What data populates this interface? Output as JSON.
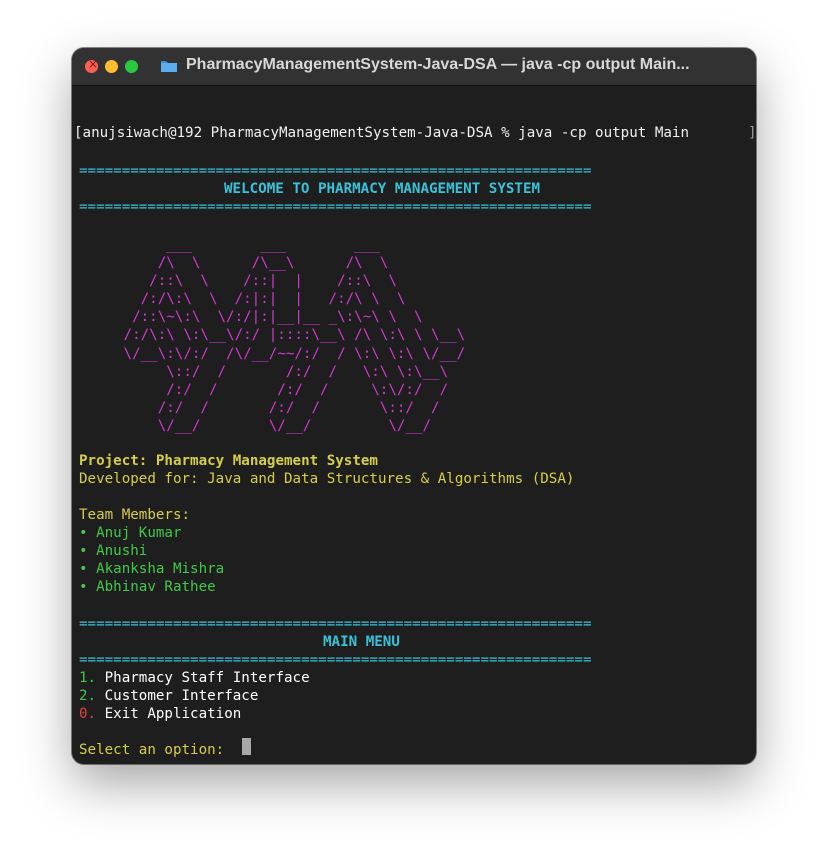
{
  "window": {
    "title": "PharmacyManagementSystem-Java-DSA — java -cp output Main..."
  },
  "terminal": {
    "prompt": "[anujsiwach@192 PharmacyManagementSystem-Java-DSA % java -cp output Main",
    "prompt_end": "]",
    "separator": "============================================================",
    "welcome": "WELCOME TO PHARMACY MANAGEMENT SYSTEM",
    "ascii_art": "      ___        ___        ___\n     /\\  \\      /\\__\\      /\\  \\\n    /::\\  \\    /::|  |    /::\\  \\\n   /:/\\:\\  \\  /:|:|  |   /:/\\ \\  \\\n  /::\\~\\:\\  \\/:/|:|__|__ _\\:\\~\\ \\  \\\n /:/\\:\\ \\:\\__\\/:/ |::::\\__\\ /\\ \\:\\ \\ \\__\\\n \\/__\\:\\/:/  /\\/__/~~/:/  / \\:\\ \\:\\ \\/__/\n      \\::/  /       /:/  /   \\:\\ \\:\\__\\\n      /:/  /       /:/  /     \\:\\/:/  /\n     /:/  /       /:/  /       \\::/  /\n     \\/__/        \\/__/         \\/__/",
    "project_line": "Project: Pharmacy Management System",
    "developed_line": "Developed for: Java and Data Structures & Algorithms (DSA)",
    "team_label": "Team Members:",
    "team_members": [
      "Anuj Kumar",
      "Anushi",
      "Akanksha Mishra",
      "Abhinav Rathee"
    ],
    "bullet": "•",
    "menu_title": "MAIN MENU",
    "menu_items": [
      {
        "number": "1.",
        "label": "Pharmacy Staff Interface"
      },
      {
        "number": "2.",
        "label": "Customer Interface"
      },
      {
        "number": "0.",
        "label": "Exit Application"
      }
    ],
    "select_prompt": "Select an option: "
  },
  "colors": {
    "separator": "#39c2d9",
    "ascii": "#d338d2",
    "project": "#d6cf45",
    "team": "#41c94a",
    "exit": "#e6423a"
  },
  "icons": {
    "folder": "folder-icon",
    "close": "close-icon"
  }
}
